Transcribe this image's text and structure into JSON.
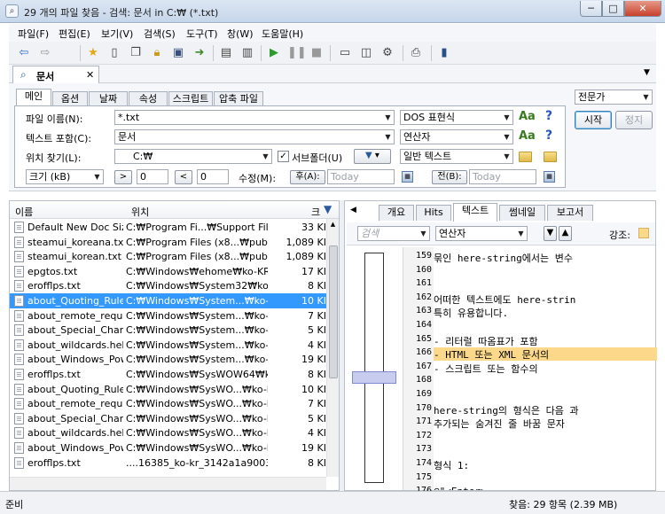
{
  "window": {
    "title": "29 개의 파일 찾음 - 검색: 문서 in C:₩ (*.txt)",
    "min": "─",
    "max": "□",
    "close": "✕"
  },
  "menu": [
    "파일(F)",
    "편집(E)",
    "보기(V)",
    "검색(S)",
    "도구(T)",
    "창(W)",
    "도움말(H)"
  ],
  "toolbar_icons": [
    "back-icon",
    "forward-icon",
    "favorites-icon",
    "new-icon",
    "copy-icon",
    "lock-icon",
    "save-icon",
    "export-icon",
    "report-icon",
    "clipboard-icon",
    "start-icon",
    "pause-icon",
    "stop-icon",
    "layout1-icon",
    "layout2-icon",
    "settings-icon",
    "print-icon",
    "info-icon"
  ],
  "doc_tab": {
    "label": "문서",
    "close": "✕"
  },
  "panel_tabs": [
    "메인",
    "옵션",
    "날짜",
    "속성",
    "스크립트",
    "압축 파일"
  ],
  "search": {
    "filename_label": "파일 이름(N):",
    "filename_value": "*.txt",
    "filename_mode": "DOS 표현식",
    "text_label": "텍스트 포함(C):",
    "text_value": "문서",
    "text_mode": "연산자",
    "location_label": "위치 찾기(L):",
    "location_value": "C:₩",
    "subfolders_label": "서브폴더(U)",
    "location_mode": "일반 텍스트",
    "size_unit": "크기 (kB)",
    "size_min": "0",
    "size_max": "0",
    "modified_label": "수정(M):",
    "after_label": "후(A):",
    "after_value": "Today",
    "before_label": "전(B):",
    "before_value": "Today",
    "aa": "Aa",
    "help": "?"
  },
  "mode": {
    "value": "전문가"
  },
  "actions": {
    "start": "시작",
    "stop": "정지"
  },
  "list": {
    "headers": {
      "name": "이름",
      "path": "위치",
      "size": "크"
    },
    "rows": [
      {
        "name": "Default New Doc Siz...",
        "path": "C:₩Program Fi...₩Support Files₩",
        "size": "33 KI"
      },
      {
        "name": "steamui_koreana.txt",
        "path": "C:₩Program Files (x8...₩public₩",
        "size": "1,089 KI"
      },
      {
        "name": "steamui_korean.txt",
        "path": "C:₩Program Files (x8...₩public₩",
        "size": "1,089 KI"
      },
      {
        "name": "epgtos.txt",
        "path": "C:₩Windows₩ehome₩ko-KR₩",
        "size": "17 KI"
      },
      {
        "name": "erofflps.txt",
        "path": "C:₩Windows₩System32₩ko-KR₩",
        "size": "8 KI"
      },
      {
        "name": "about_Quoting_Rules....",
        "path": "C:₩Windows₩System...₩ko-KR₩",
        "size": "10 KI"
      },
      {
        "name": "about_remote_require...",
        "path": "C:₩Windows₩System...₩ko-KR₩",
        "size": "7 KI"
      },
      {
        "name": "about_Special_Charac...",
        "path": "C:₩Windows₩System...₩ko-KR₩",
        "size": "5 KI"
      },
      {
        "name": "about_wildcards.help....",
        "path": "C:₩Windows₩System...₩ko-KR₩",
        "size": "4 KI"
      },
      {
        "name": "about_Windows_Pow...",
        "path": "C:₩Windows₩System...₩ko-KR₩",
        "size": "19 KI"
      },
      {
        "name": "erofflps.txt",
        "path": "C:₩Windows₩SysWOW64₩ko-KR₩",
        "size": "8 KI"
      },
      {
        "name": "about_Quoting_Rules....",
        "path": "C:₩Windows₩SysWO...₩ko-KR₩",
        "size": "10 KI"
      },
      {
        "name": "about_remote_require...",
        "path": "C:₩Windows₩SysWO...₩ko-KR₩",
        "size": "7 KI"
      },
      {
        "name": "about_Special_Charac...",
        "path": "C:₩Windows₩SysWO...₩ko-KR₩",
        "size": "5 KI"
      },
      {
        "name": "about_wildcards.help....",
        "path": "C:₩Windows₩SysWO...₩ko-KR₩",
        "size": "4 KI"
      },
      {
        "name": "about_Windows_Pow...",
        "path": "C:₩Windows₩SysWO...₩ko-KR₩",
        "size": "19 KI"
      },
      {
        "name": "erofflps.txt",
        "path": "....16385_ko-kr_3142a1a9003454ef",
        "size": "8 KI"
      }
    ],
    "selected_index": 5
  },
  "preview": {
    "tabs": [
      "개요",
      "Hits",
      "텍스트",
      "썸네일",
      "보고서"
    ],
    "search_placeholder": "검색",
    "mode": "연산자",
    "highlight_label": "강조:",
    "lines": [
      {
        "n": "159",
        "t": "  묶인 here-string에서는 변수"
      },
      {
        "n": "160",
        "t": ""
      },
      {
        "n": "161",
        "t": ""
      },
      {
        "n": "162",
        "t": "  어떠한 텍스트에도 here-strin"
      },
      {
        "n": "163",
        "t": "  특히 유용합니다."
      },
      {
        "n": "164",
        "t": ""
      },
      {
        "n": "165",
        "t": "      - 리터럴 따옴표가 포함"
      },
      {
        "n": "166",
        "t": "      - HTML 또는 XML 문서의"
      },
      {
        "n": "167",
        "t": "      - 스크립트 또는 함수의"
      },
      {
        "n": "168",
        "t": ""
      },
      {
        "n": "169",
        "t": ""
      },
      {
        "n": "170",
        "t": "here-string의 형식은 다음 과"
      },
      {
        "n": "171",
        "t": "추가되는 숨겨진 줄 바꿈 문자"
      },
      {
        "n": "172",
        "t": ""
      },
      {
        "n": "173",
        "t": ""
      },
      {
        "n": "174",
        "t": "  형식 1:"
      },
      {
        "n": "175",
        "t": ""
      },
      {
        "n": "176",
        "t": "  @\"<Enter>"
      }
    ],
    "highlight_line": "166"
  },
  "status": {
    "left": "준비",
    "right": "찾음: 29 항목 (2.39 MB)"
  },
  "colors": {
    "selection": "#3399ff",
    "highlight": "#fcd98a",
    "keyword": "#ffeb3b"
  }
}
